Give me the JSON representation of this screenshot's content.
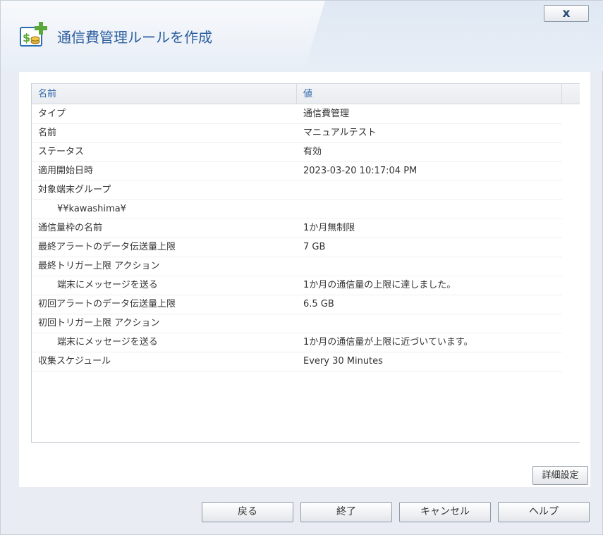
{
  "dialog": {
    "title": "通信費管理ルールを作成",
    "close_label": "x"
  },
  "table": {
    "headers": {
      "name": "名前",
      "value": "値"
    },
    "rows": [
      {
        "name": "タイプ",
        "value": "通信費管理",
        "indent": false
      },
      {
        "name": "名前",
        "value": "マニュアルテスト",
        "indent": false
      },
      {
        "name": "ステータス",
        "value": "有効",
        "indent": false
      },
      {
        "name": "適用開始日時",
        "value": "2023-03-20 10:17:04 PM",
        "indent": false
      },
      {
        "name": "対象端末グループ",
        "value": "",
        "indent": false
      },
      {
        "name": "¥¥kawashima¥",
        "value": "",
        "indent": true
      },
      {
        "name": "通信量枠の名前",
        "value": "1か月無制限",
        "indent": false
      },
      {
        "name": "最終アラートのデータ伝送量上限",
        "value": "7 GB",
        "indent": false
      },
      {
        "name": "最終トリガー上限 アクション",
        "value": "",
        "indent": false
      },
      {
        "name": "端末にメッセージを送る",
        "value": "1か月の通信量の上限に達しました。",
        "indent": true
      },
      {
        "name": "初回アラートのデータ伝送量上限",
        "value": "6.5 GB",
        "indent": false
      },
      {
        "name": "初回トリガー上限 アクション",
        "value": "",
        "indent": false
      },
      {
        "name": "端末にメッセージを送る",
        "value": "1か月の通信量が上限に近づいています。",
        "indent": true
      },
      {
        "name": "収集スケジュール",
        "value": "Every 30 Minutes",
        "indent": false
      }
    ]
  },
  "buttons": {
    "advanced": "詳細設定",
    "back": "戻る",
    "finish": "終了",
    "cancel": "キャンセル",
    "help": "ヘルプ"
  },
  "colors": {
    "title": "#2c5e9e",
    "header_text": "#2d64a8",
    "icon_green": "#5aa83a",
    "icon_blue": "#2a6fb5"
  },
  "icons": {
    "title_icon": "add-billing-rule-icon"
  }
}
